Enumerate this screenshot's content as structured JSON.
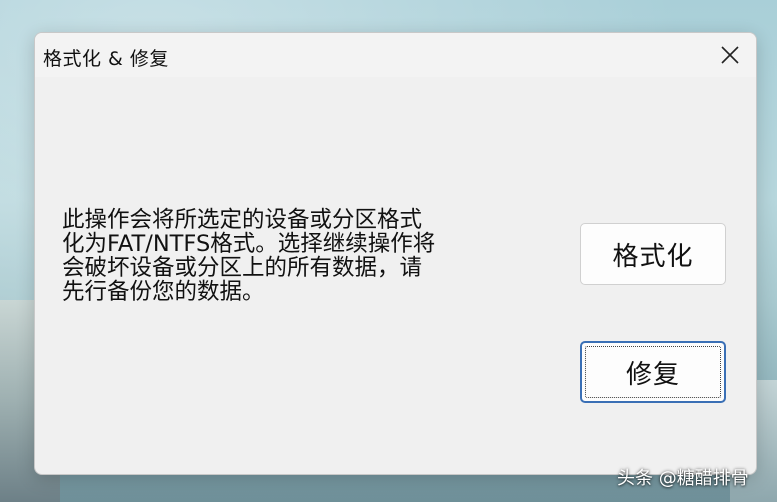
{
  "window": {
    "title": "格式化 & 修复",
    "close_icon": "close-icon"
  },
  "dialog": {
    "message": "此操作会将所选定的设备或分区格式\n化为FAT/NTFS格式。选择继续操作将\n会破坏设备或分区上的所有数据，请\n先行备份您的数据。",
    "format_button_label": "格式化",
    "repair_button_label": "修复"
  },
  "watermark": {
    "text": "头条 @糖醋排骨"
  },
  "colors": {
    "window_bg": "#f0f0f0",
    "focus_border": "#3a6fb5"
  }
}
